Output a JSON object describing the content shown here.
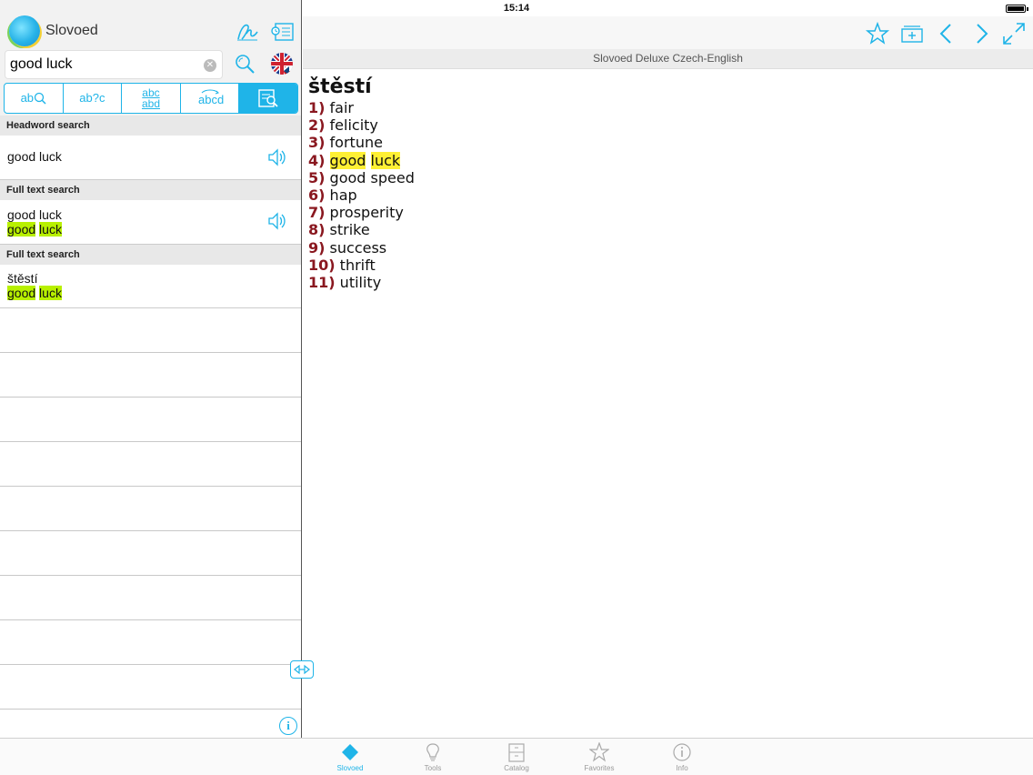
{
  "status": {
    "time": "15:14",
    "left_icons": "✈ ᯤ"
  },
  "app": {
    "name": "Slovoed"
  },
  "search": {
    "value": "good luck",
    "placeholder": ""
  },
  "modes": [
    {
      "label": "ab",
      "icon": "word-search-icon"
    },
    {
      "label": "ab?c",
      "icon": "wildcard-search-icon"
    },
    {
      "label": "abc abd",
      "icon": "fuzzy-search-icon"
    },
    {
      "label": "abcd",
      "icon": "anagram-search-icon"
    },
    {
      "label": "",
      "icon": "full-text-search-icon"
    }
  ],
  "results": {
    "headword_header": "Headword search",
    "headword_item": "good luck",
    "fulltext_header_1": "Full text search",
    "fulltext_item_1": {
      "main": "good luck",
      "sub_a": "good",
      "sub_b": "luck"
    },
    "fulltext_header_2": "Full text search",
    "fulltext_item_2": {
      "main": "štěstí",
      "sub_a": "good",
      "sub_b": "luck"
    }
  },
  "dictionary_title": "Slovoed Deluxe Czech-English",
  "article": {
    "headword": "štěstí",
    "senses": [
      {
        "num": "1)",
        "text": "fair"
      },
      {
        "num": "2)",
        "text": "felicity"
      },
      {
        "num": "3)",
        "text": "fortune"
      },
      {
        "num": "4)",
        "text_a": "good",
        "text_b": "luck",
        "highlighted": true
      },
      {
        "num": "5)",
        "text": "good speed"
      },
      {
        "num": "6)",
        "text": "hap"
      },
      {
        "num": "7)",
        "text": "prosperity"
      },
      {
        "num": "8)",
        "text": "strike"
      },
      {
        "num": "9)",
        "text": "success"
      },
      {
        "num": "10)",
        "text": "thrift"
      },
      {
        "num": "11)",
        "text": "utility"
      }
    ]
  },
  "info_label": "i",
  "tabs": [
    {
      "label": "Slovoed",
      "active": true
    },
    {
      "label": "Tools",
      "active": false
    },
    {
      "label": "Catalog",
      "active": false
    },
    {
      "label": "Favorites",
      "active": false
    },
    {
      "label": "Info",
      "active": false
    }
  ],
  "colors": {
    "accent": "#1fb4e8",
    "sense_number": "#8a1820",
    "highlight_yellow": "#fff034",
    "highlight_green": "#b8f000"
  }
}
